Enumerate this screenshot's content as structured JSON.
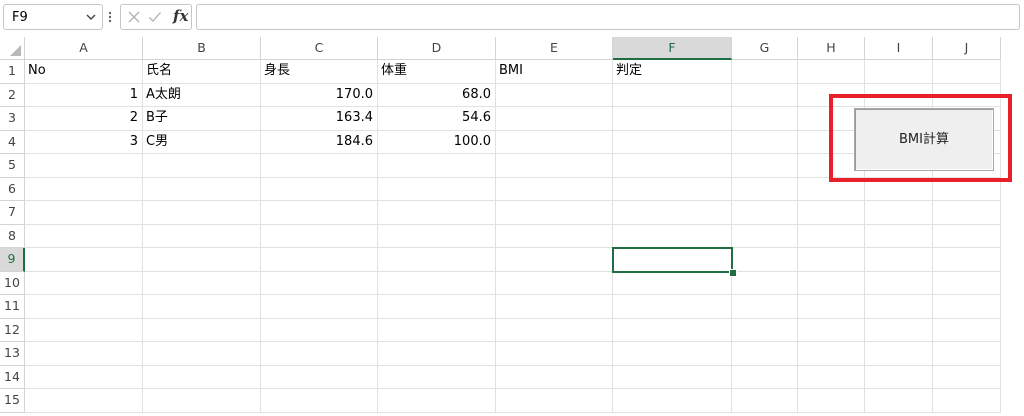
{
  "formula_bar": {
    "name_box": "F9",
    "formula": ""
  },
  "sheet": {
    "columns": [
      "A",
      "B",
      "C",
      "D",
      "E",
      "F",
      "G",
      "H",
      "I",
      "J"
    ],
    "rows": [
      "1",
      "2",
      "3",
      "4",
      "5",
      "6",
      "7",
      "8",
      "9",
      "10",
      "11",
      "12",
      "13",
      "14",
      "15"
    ],
    "active_column": "F",
    "active_row": "9",
    "cells": {
      "A1": "No",
      "B1": "氏名",
      "C1": "身長",
      "D1": "体重",
      "E1": "BMI",
      "F1": "判定",
      "A2": "1",
      "B2": "A太朗",
      "C2": "170.0",
      "D2": "68.0",
      "A3": "2",
      "B3": "B子",
      "C3": "163.4",
      "D3": "54.6",
      "A4": "3",
      "B4": "C男",
      "C4": "184.6",
      "D4": "100.0"
    }
  },
  "button": {
    "label": "BMI計算"
  },
  "colors": {
    "accent": "#1f6e43",
    "highlight": "#e8202a"
  }
}
